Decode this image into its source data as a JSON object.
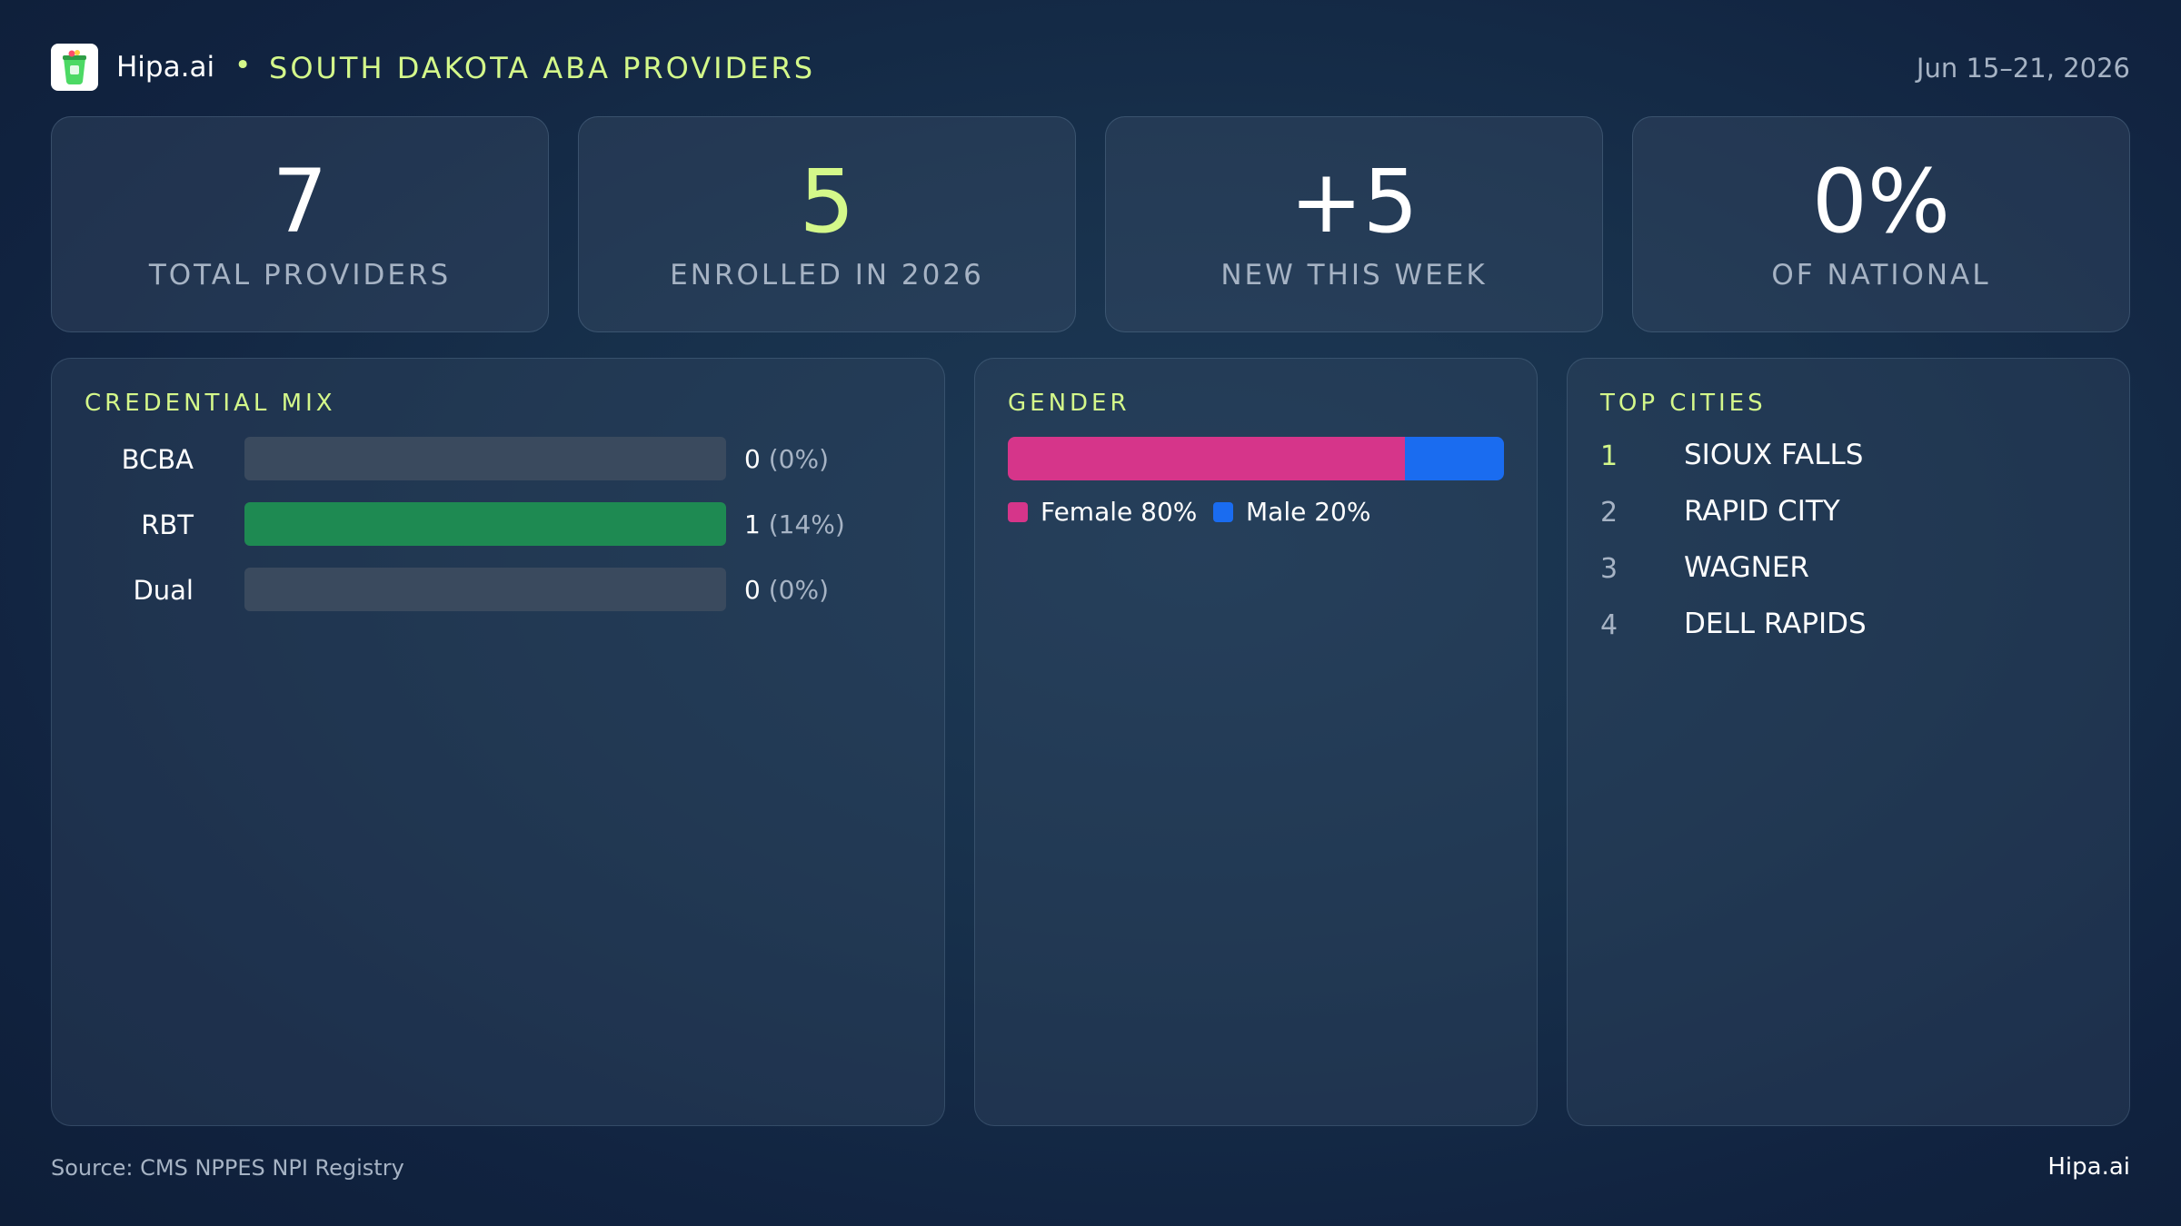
{
  "header": {
    "brand": "Hipa.ai",
    "separator": "•",
    "title": "SOUTH DAKOTA  ABA PROVIDERS",
    "date_range": "Jun 15–21, 2026"
  },
  "stats": [
    {
      "value": "7",
      "label": "TOTAL  PROVIDERS"
    },
    {
      "value": "5",
      "label": "ENROLLED IN 2026"
    },
    {
      "value": "+5",
      "label": "NEW THIS WEEK"
    },
    {
      "value": "0%",
      "label": "OF NATIONAL"
    }
  ],
  "credential_mix": {
    "title": "CREDENTIAL  MIX",
    "rows": [
      {
        "label": "BCBA",
        "count": "0",
        "pct": "(0%)",
        "fraction": 0
      },
      {
        "label": "RBT",
        "count": "1",
        "pct": "(14%)",
        "fraction": 1
      },
      {
        "label": "Dual",
        "count": "0",
        "pct": "(0%)",
        "fraction": 0
      }
    ]
  },
  "gender": {
    "title": "GENDER",
    "female": {
      "label": "Female 80%",
      "share": 0.8,
      "color": "#d6358a"
    },
    "male": {
      "label": "Male 20%",
      "share": 0.2,
      "color": "#1a6cf0"
    }
  },
  "top_cities": {
    "title": "TOP CITIES",
    "items": [
      {
        "rank": "1",
        "name": "SIOUX FALLS"
      },
      {
        "rank": "2",
        "name": "RAPID CITY"
      },
      {
        "rank": "3",
        "name": "WAGNER"
      },
      {
        "rank": "4",
        "name": "DELL RAPIDS"
      }
    ]
  },
  "footer": {
    "source": "Source: CMS NPPES NPI Registry",
    "brand": "Hipa.ai"
  },
  "colors": {
    "accent": "#d4f88a",
    "bar_fill": "#1e8a52",
    "female": "#d6358a",
    "male": "#1a6cf0"
  }
}
